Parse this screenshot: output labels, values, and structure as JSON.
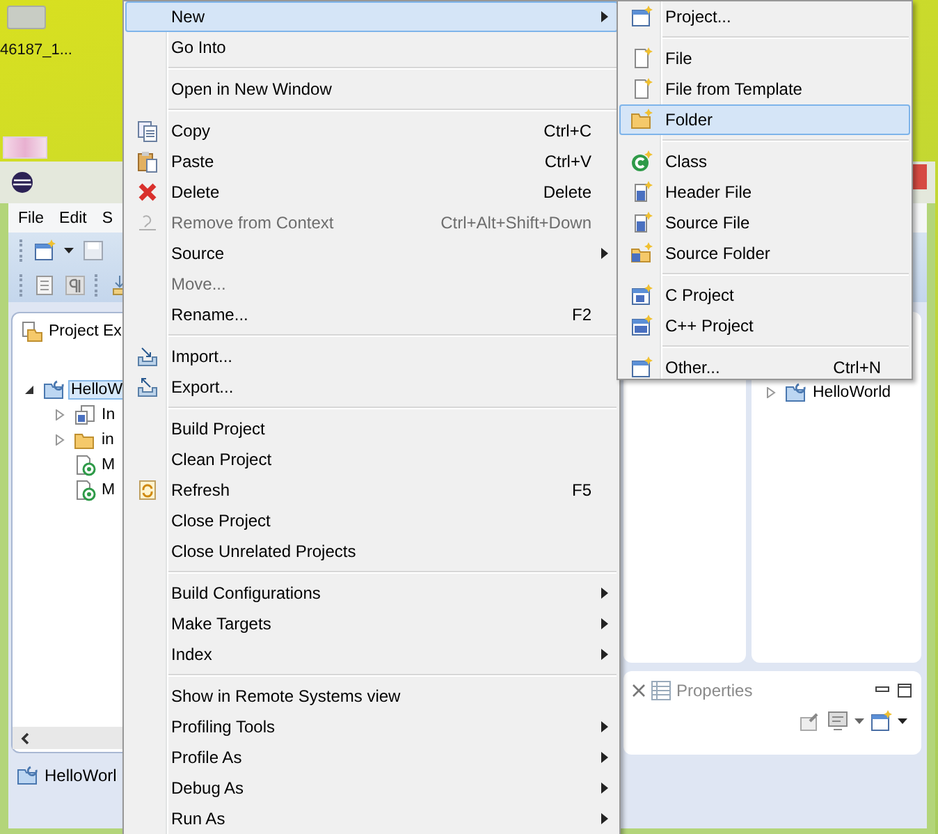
{
  "desktop_icons": [
    {
      "label": "46187_1..."
    }
  ],
  "window": {
    "menu_bar": [
      "File",
      "Edit",
      "S"
    ],
    "project_explorer": {
      "title": "Project Ex",
      "tree": [
        {
          "label": "HelloW",
          "selected": true,
          "expanded": true,
          "children": [
            {
              "label": "In",
              "expanded": false
            },
            {
              "label": "in",
              "expanded": false
            },
            {
              "label": "M"
            },
            {
              "label": "M"
            }
          ]
        }
      ]
    },
    "status": "HelloWorl",
    "right_tree": [
      {
        "label": "HelloWorld",
        "expanded": false
      }
    ],
    "bottom_panel": {
      "tab": "Properties"
    }
  },
  "context_menu": {
    "groups": [
      [
        {
          "label": "New",
          "submenu": true,
          "selected": true,
          "disabled": false
        },
        {
          "label": "Go Into",
          "submenu": false,
          "selected": false,
          "disabled": false
        }
      ],
      [
        {
          "label": "Open in New Window",
          "submenu": false,
          "selected": false,
          "disabled": false
        }
      ],
      [
        {
          "label": "Copy",
          "shortcut": "Ctrl+C",
          "submenu": false,
          "selected": false,
          "disabled": false
        },
        {
          "label": "Paste",
          "shortcut": "Ctrl+V",
          "submenu": false,
          "selected": false,
          "disabled": false
        },
        {
          "label": "Delete",
          "shortcut": "Delete",
          "submenu": false,
          "selected": false,
          "disabled": false
        },
        {
          "label": "Remove from Context",
          "shortcut": "Ctrl+Alt+Shift+Down",
          "submenu": false,
          "selected": false,
          "disabled": true
        },
        {
          "label": "Source",
          "submenu": true,
          "selected": false,
          "disabled": false
        },
        {
          "label": "Move...",
          "submenu": false,
          "selected": false,
          "disabled": true
        },
        {
          "label": "Rename...",
          "shortcut": "F2",
          "submenu": false,
          "selected": false,
          "disabled": false
        }
      ],
      [
        {
          "label": "Import...",
          "submenu": false,
          "selected": false,
          "disabled": false
        },
        {
          "label": "Export...",
          "submenu": false,
          "selected": false,
          "disabled": false
        }
      ],
      [
        {
          "label": "Build Project",
          "submenu": false,
          "selected": false,
          "disabled": false
        },
        {
          "label": "Clean Project",
          "submenu": false,
          "selected": false,
          "disabled": false
        },
        {
          "label": "Refresh",
          "shortcut": "F5",
          "submenu": false,
          "selected": false,
          "disabled": false
        },
        {
          "label": "Close Project",
          "submenu": false,
          "selected": false,
          "disabled": false
        },
        {
          "label": "Close Unrelated Projects",
          "submenu": false,
          "selected": false,
          "disabled": false
        }
      ],
      [
        {
          "label": "Build Configurations",
          "submenu": true,
          "selected": false,
          "disabled": false
        },
        {
          "label": "Make Targets",
          "submenu": true,
          "selected": false,
          "disabled": false
        },
        {
          "label": "Index",
          "submenu": true,
          "selected": false,
          "disabled": false
        }
      ],
      [
        {
          "label": "Show in Remote Systems view",
          "submenu": false,
          "selected": false,
          "disabled": false
        },
        {
          "label": "Profiling Tools",
          "submenu": true,
          "selected": false,
          "disabled": false
        },
        {
          "label": "Profile As",
          "submenu": true,
          "selected": false,
          "disabled": false
        },
        {
          "label": "Debug As",
          "submenu": true,
          "selected": false,
          "disabled": false
        },
        {
          "label": "Run As",
          "submenu": true,
          "selected": false,
          "disabled": false
        }
      ]
    ]
  },
  "new_submenu": {
    "groups": [
      [
        {
          "label": "Project...",
          "selected": false
        }
      ],
      [
        {
          "label": "File",
          "selected": false
        },
        {
          "label": "File from Template",
          "selected": false
        },
        {
          "label": "Folder",
          "selected": true
        }
      ],
      [
        {
          "label": "Class",
          "selected": false
        },
        {
          "label": "Header File",
          "selected": false
        },
        {
          "label": "Source File",
          "selected": false
        },
        {
          "label": "Source Folder",
          "selected": false
        }
      ],
      [
        {
          "label": "C Project",
          "selected": false
        },
        {
          "label": "C++ Project",
          "selected": false
        }
      ],
      [
        {
          "label": "Other...",
          "shortcut": "Ctrl+N",
          "selected": false
        }
      ]
    ]
  }
}
